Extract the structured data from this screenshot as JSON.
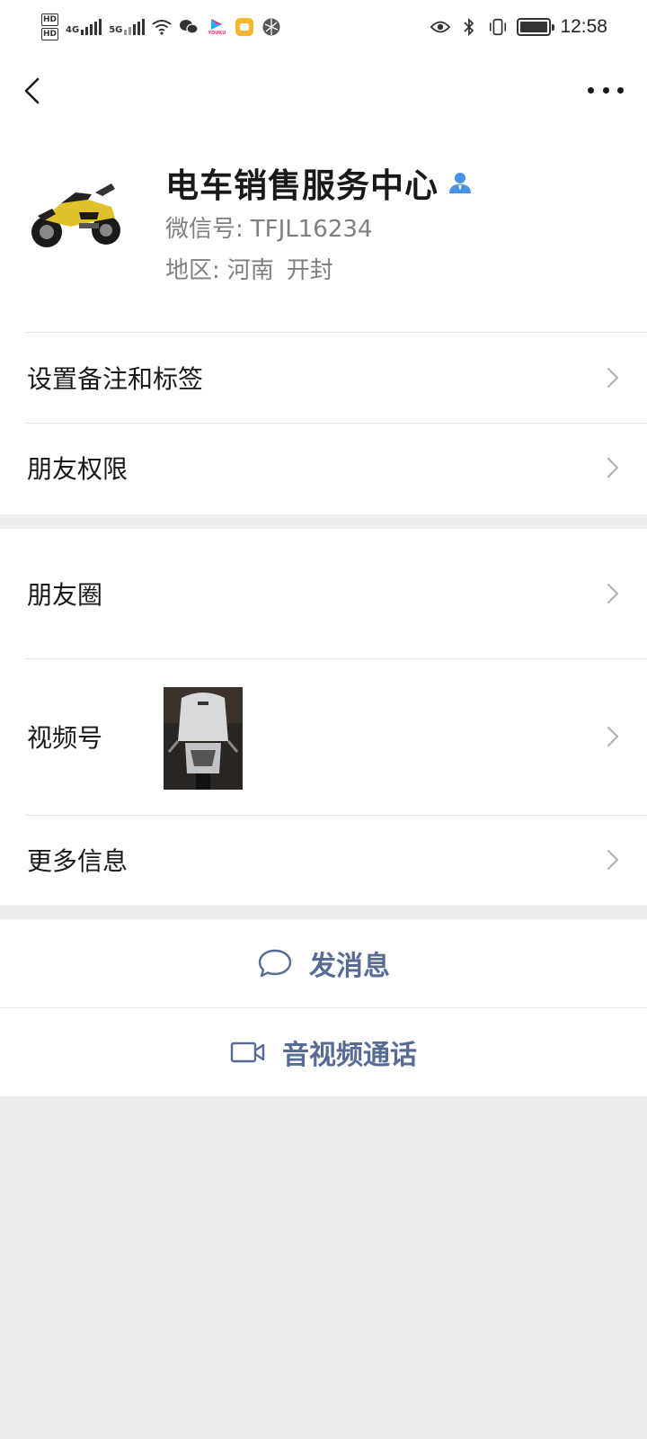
{
  "status_bar": {
    "net_1": "4G",
    "net_2": "5G",
    "hd_1": "HD",
    "hd_2": "HD",
    "time": "12:58",
    "app_icon_label": "YOUKU",
    "icons": [
      "wifi-icon",
      "wechat-icon",
      "youku-icon",
      "orange-app-icon",
      "browser-icon",
      "eye-icon",
      "bluetooth-icon",
      "vibrate-icon",
      "battery-icon"
    ]
  },
  "nav": {
    "back_icon": "chevron-left-icon",
    "more_icon": "more-dots-icon"
  },
  "profile": {
    "name": "电车销售服务中心",
    "wechat_id_label": "微信号:",
    "wechat_id": "TFJL16234",
    "region_label": "地区:",
    "region_province": "河南",
    "region_city": "开封",
    "verified_icon": "person-icon"
  },
  "group1": {
    "remark_label": "设置备注和标签",
    "permission_label": "朋友权限"
  },
  "group2": {
    "moments_label": "朋友圈",
    "channels_label": "视频号",
    "more_info_label": "更多信息"
  },
  "actions": {
    "message_label": "发消息",
    "call_label": "音视频通话"
  },
  "colors": {
    "link_blue": "#576b95",
    "background": "#ededed",
    "divider": "#e5e5e5",
    "badge_blue": "#4a90e2"
  }
}
